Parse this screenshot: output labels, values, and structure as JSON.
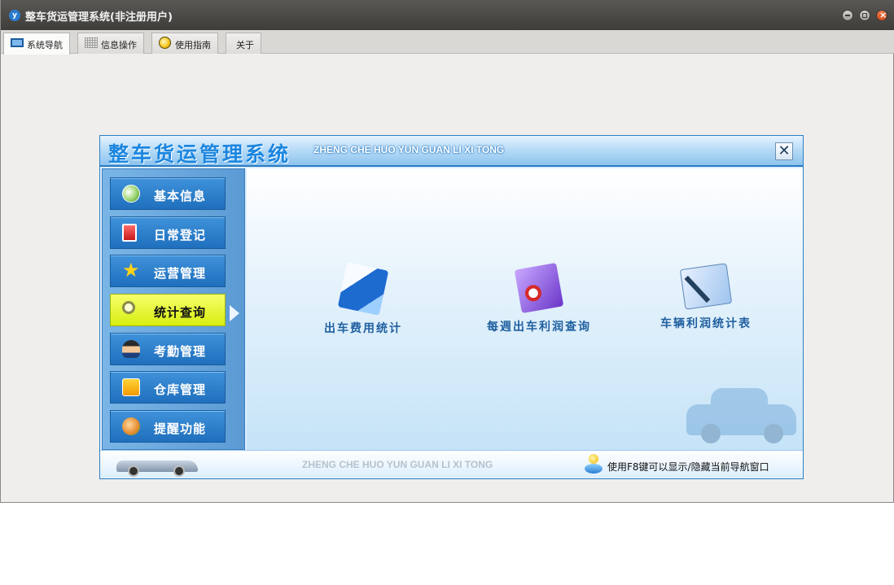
{
  "window": {
    "title": "整车货运管理系统(非注册用户)"
  },
  "tabs": [
    {
      "label": "系统导航",
      "icon": "monitor-icon",
      "active": true
    },
    {
      "label": "信息操作",
      "icon": "grid-icon",
      "active": false
    },
    {
      "label": "使用指南",
      "icon": "help-circle-icon",
      "active": false
    },
    {
      "label": "关于",
      "icon": null,
      "active": false
    }
  ],
  "nav_panel": {
    "title": "整车货运管理系统",
    "subtitle": "ZHENG CHE HUO YUN GUAN LI XI TONG",
    "close_symbol": "✕",
    "menu": [
      {
        "label": "基本信息",
        "icon": "contacts-icon",
        "active": false
      },
      {
        "label": "日常登记",
        "icon": "monitor-red-icon",
        "active": false
      },
      {
        "label": "运营管理",
        "icon": "star-icon",
        "active": false
      },
      {
        "label": "统计查询",
        "icon": "magnifier-icon",
        "active": true
      },
      {
        "label": "考勤管理",
        "icon": "user-icon",
        "active": false
      },
      {
        "label": "仓库管理",
        "icon": "rss-icon",
        "active": false
      },
      {
        "label": "提醒功能",
        "icon": "users-icon",
        "active": false
      }
    ],
    "features": [
      {
        "label": "出车费用统计",
        "icon": "pen-document-icon"
      },
      {
        "label": "每週出车利润查询",
        "icon": "report-icon"
      },
      {
        "label": "车辆利润统计表",
        "icon": "statistics-sheet-icon"
      }
    ],
    "footer": {
      "text": "ZHENG CHE HUO YUN GUAN LI XI TONG",
      "hint": "使用F8键可以显示/隐藏当前导航窗口"
    }
  },
  "colors": {
    "titlebar": "#3e3d39",
    "menu_button": "#1f6fbd",
    "menu_active": "#d7ee10",
    "accent_text": "#1f5f9f"
  }
}
